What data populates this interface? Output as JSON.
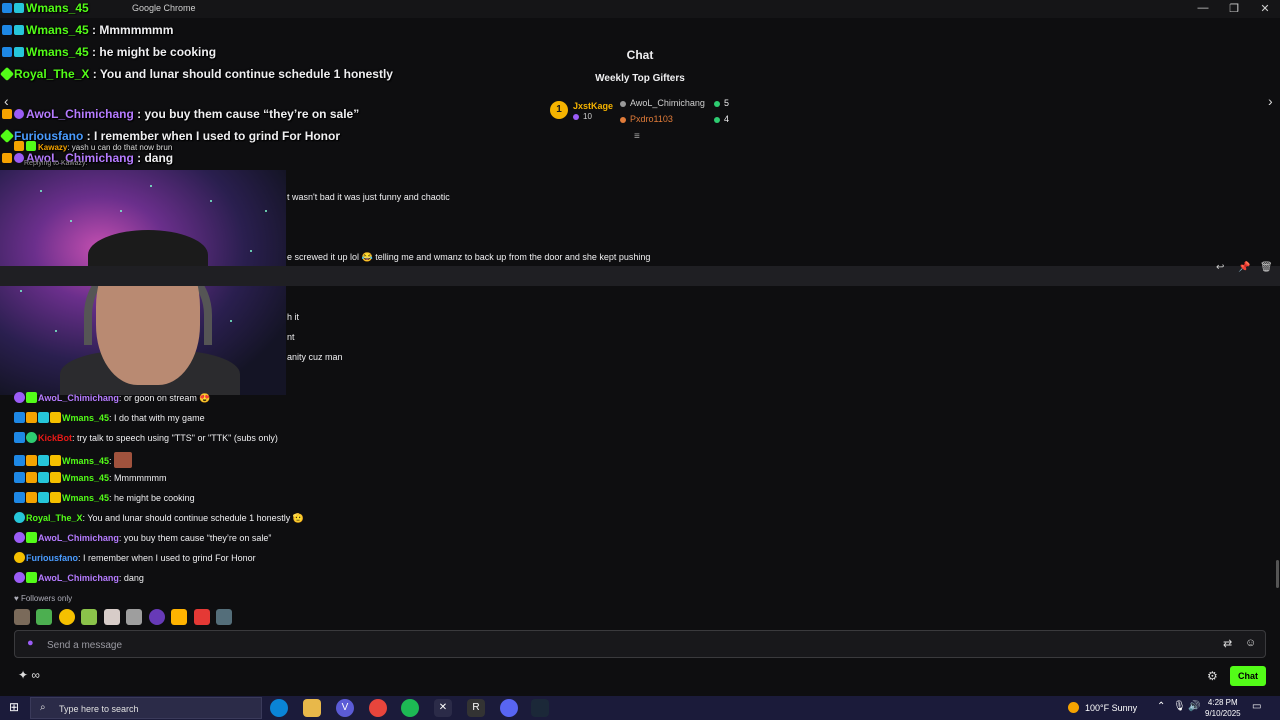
{
  "window": {
    "title": "Google Chrome",
    "minimize": "—",
    "maximize": "❐",
    "close": "✕"
  },
  "chat": {
    "header": "Chat",
    "weekly_title": "Weekly Top Gifters",
    "first": {
      "rank": "1",
      "name": "JxstKage",
      "count": "10"
    },
    "gifters": [
      {
        "name": "AwoL_Chimichang",
        "count": "5"
      },
      {
        "name": "Pxdro1103",
        "count": "4"
      }
    ],
    "prev_arrow": "‹",
    "next_arrow": "›",
    "collapse": "≡"
  },
  "overlay": [
    {
      "user": "Wmans_45",
      "text": "",
      "color": "#53fc18"
    },
    {
      "user": "Wmans_45",
      "text": " : Mmmmmmm",
      "color": "#53fc18"
    },
    {
      "user": "Wmans_45",
      "text": " : he might be cooking",
      "color": "#53fc18"
    },
    {
      "user": "Royal_The_X",
      "text": " : You and lunar should continue schedule 1 honestly",
      "color": "#53fc18"
    },
    {
      "user": "AwoL_Chimichang",
      "text": " : you buy them cause “they’re on sale”",
      "color": "#b57bff"
    },
    {
      "user": "Furiousfano",
      "text": " : I remember when I used to grind For Honor",
      "color": "#4a9cff"
    },
    {
      "user": "AwoL_Chimichang",
      "text": " : dang",
      "color": "#b57bff"
    }
  ],
  "overlay_small": {
    "user": "Kawazy",
    "text": ": yash u can do that now brun",
    "reply": "Replying to Kawazy:"
  },
  "partials": [
    {
      "text": "t wasn't bad it was just funny and chaotic"
    },
    {
      "text": "e screwed it up lol 😂 telling me and wmanz to back up from the door and she kept pushing"
    },
    {
      "text": "h it"
    },
    {
      "text": "nt"
    },
    {
      "text": "anity cuz man"
    }
  ],
  "row_actions": {
    "reply": "↩",
    "pin": "📌",
    "delete": "🗑"
  },
  "messages": [
    {
      "user": "AwoL_Chimichang",
      "text": ": or goon on stream 😍",
      "color": "#b57bff"
    },
    {
      "user": "Wmans_45",
      "text": ": I do that with my game",
      "color": "#53fc18"
    },
    {
      "user": "KickBot",
      "text": ": try talk to speech using \"TTS\" or \"TTK\" (subs only)",
      "color": "#e91916"
    },
    {
      "user": "Wmans_45",
      "text": ":",
      "color": "#53fc18"
    },
    {
      "user": "Wmans_45",
      "text": ": Mmmmmmm",
      "color": "#53fc18"
    },
    {
      "user": "Wmans_45",
      "text": ": he might be cooking",
      "color": "#53fc18"
    },
    {
      "user": "Royal_The_X",
      "text": ": You and lunar should continue schedule 1 honestly 🫡",
      "color": "#53fc18"
    },
    {
      "user": "AwoL_Chimichang",
      "text": ": you buy them cause “they’re on sale”",
      "color": "#b57bff"
    },
    {
      "user": "Furiousfano",
      "text": ": I remember when I used to grind For Honor",
      "color": "#4a9cff"
    },
    {
      "user": "AwoL_Chimichang",
      "text": ": dang",
      "color": "#b57bff"
    }
  ],
  "followers_only": "♥ Followers only",
  "input": {
    "placeholder": "Send a message"
  },
  "chat_button": "Chat",
  "taskbar": {
    "search_placeholder": "Type here to search",
    "weather": "100°F  Sunny",
    "time": "4:28 PM",
    "date": "9/10/2025"
  }
}
